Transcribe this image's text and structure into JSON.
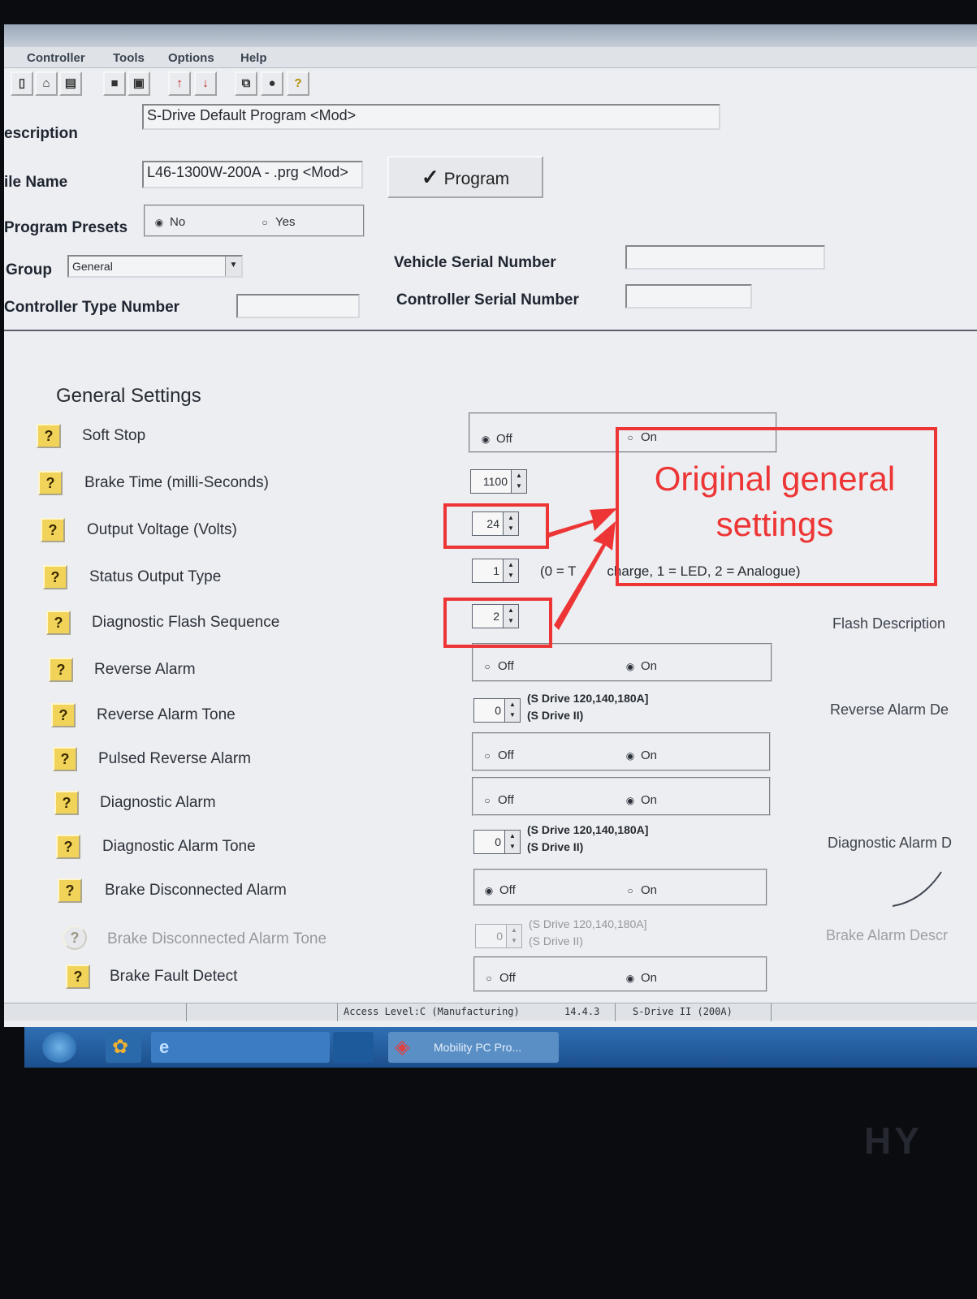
{
  "menu": {
    "items": [
      "Controller",
      "Tools",
      "Options",
      "Help"
    ]
  },
  "toolbar": {
    "buttons": [
      "new-icon",
      "open-icon",
      "print-icon",
      "save-icon",
      "save-as-icon",
      "upload-icon",
      "download-icon",
      "copy-icon",
      "lock-icon",
      "help-icon"
    ]
  },
  "header": {
    "description_label": "escription",
    "description_value": "S-Drive Default Program <Mod>",
    "filename_label": "ile Name",
    "filename_value": "L46-1300W-200A - .prg <Mod>",
    "program_button": "Program",
    "presets_label": "Program Presets",
    "presets_no": "No",
    "presets_yes": "Yes",
    "presets_selected": "No",
    "group_label": "Group",
    "group_value": "General",
    "vehicle_serial_label": "Vehicle Serial Number",
    "vehicle_serial_value": "",
    "controller_serial_label": "Controller Serial Number",
    "controller_serial_value": "",
    "controller_type_label": "Controller Type Number",
    "controller_type_value": ""
  },
  "settings": {
    "title": "General Settings",
    "radio_off": "Off",
    "radio_on": "On",
    "soft_stop": {
      "label": "Soft Stop",
      "selected": "Off"
    },
    "brake_time": {
      "label": "Brake Time (milli-Seconds)",
      "value": "1100"
    },
    "output_voltage": {
      "label": "Output Voltage (Volts)",
      "value": "24"
    },
    "status_output_type": {
      "label": "Status Output Type",
      "value": "1",
      "note": "(0 = T",
      "note_end": "charge, 1 = LED, 2 = Analogue)"
    },
    "diagnostic_flash_sequence": {
      "label": "Diagnostic Flash Sequence",
      "value": "2",
      "desc": "Flash Description"
    },
    "reverse_alarm": {
      "label": "Reverse Alarm",
      "selected": "On"
    },
    "reverse_alarm_tone": {
      "label": "Reverse Alarm Tone",
      "value": "0",
      "model1": "(S Drive 120,140,180A]",
      "model2": "(S Drive II)",
      "desc": "Reverse Alarm De"
    },
    "pulsed_reverse_alarm": {
      "label": "Pulsed Reverse Alarm",
      "selected": "On"
    },
    "diagnostic_alarm": {
      "label": "Diagnostic Alarm",
      "selected": "On"
    },
    "diagnostic_alarm_tone": {
      "label": "Diagnostic Alarm Tone",
      "value": "0",
      "model1": "(S Drive 120,140,180A]",
      "model2": "(S Drive II)",
      "desc": "Diagnostic Alarm D"
    },
    "brake_disconnected_alarm": {
      "label": "Brake Disconnected Alarm",
      "selected": "Off"
    },
    "brake_disconnected_alarm_tone": {
      "label": "Brake Disconnected Alarm Tone",
      "value": "0",
      "model1": "(S Drive 120,140,180A]",
      "model2": "(S Drive II)",
      "desc": "Brake Alarm Descr"
    },
    "brake_fault_detect": {
      "label": "Brake Fault Detect",
      "selected": "On"
    }
  },
  "statusbar": {
    "access": "Access Level:C (Manufacturing)",
    "version": "14.4.3",
    "controller": "S-Drive II (200A)"
  },
  "taskbar": {
    "browser_label": "",
    "ime_label": "",
    "app_label": "Mobility PC Pro..."
  },
  "annotation": {
    "line1": "Original general",
    "line2": "settings",
    "color": "#ee3535"
  },
  "colors": {
    "help_button": "#f1d35a",
    "taskbar": "#2f6fb3",
    "annotation": "#ee3535"
  }
}
